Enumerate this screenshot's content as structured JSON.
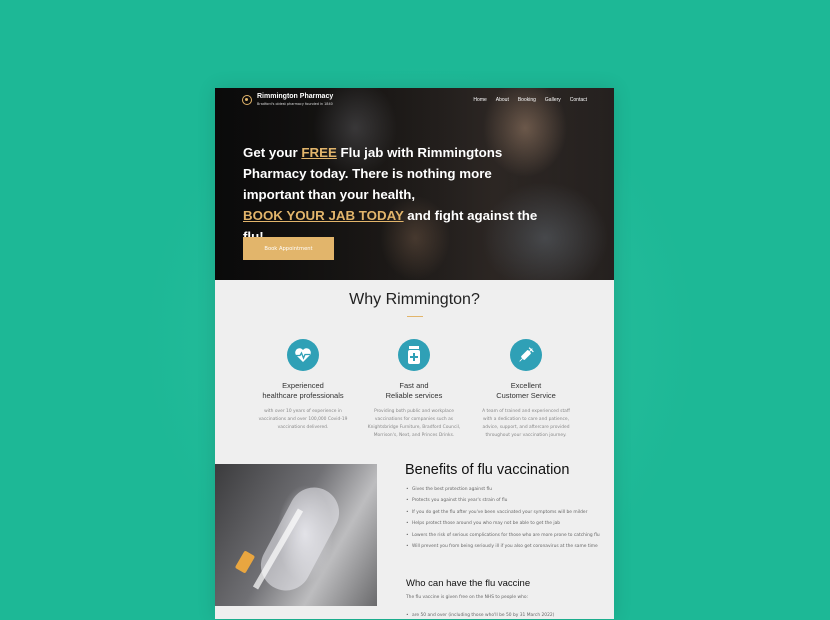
{
  "header": {
    "brand": "Rimmington Pharmacy",
    "tagline": "Bradford's oldest pharmacy founded in 1840",
    "nav": [
      "Home",
      "About",
      "Booking",
      "Gallery",
      "Contact"
    ]
  },
  "hero": {
    "part1": "Get your ",
    "free": "FREE",
    "part2": " Flu jab with Rimmingtons Pharmacy today. There is nothing more important than your health,",
    "book_link": "BOOK YOUR JAB TODAY",
    "part3": " and fight against the flu!",
    "button": "Book Appointment"
  },
  "why": {
    "title": "Why Rimmington?",
    "features": [
      {
        "icon": "heartbeat-icon",
        "title_line1": "Experienced",
        "title_line2": "healthcare professionals",
        "desc": "with over 10 years of experience in vaccinations and over 100,000 Covid-19 vaccinations delivered."
      },
      {
        "icon": "medicine-bottle-icon",
        "title_line1": "Fast and",
        "title_line2": "Reliable services",
        "desc": "Providing both public and workplace vaccinations for companies such as Knightsbridge Furniture, Bradford Council, Morrison's, Next, and Princes Drinks."
      },
      {
        "icon": "syringe-icon",
        "title_line1": "Excellent",
        "title_line2": "Customer Service",
        "desc": "A team of trained and experienced staff with a dedication to care and patience, advice, support, and aftercare provided throughout your vaccination journey."
      }
    ]
  },
  "benefits": {
    "title": "Benefits of flu vaccination",
    "items": [
      "Gives the best protection against flu",
      "Protects you against this year's strain of flu",
      "If you do get the flu after you've been vaccinated your symptoms will be milder",
      "Helps protect those around you who may not be able to get the jab",
      "Lowers the risk of serious complications for those who are more prone to catching flu",
      "Will prevent you from being seriously ill if you also get coronavirus at the same time"
    ]
  },
  "who": {
    "title": "Who can have the flu vaccine",
    "intro": "The flu vaccine is given free on the NHS to people who:",
    "first_item": "are 50 and over (including those who'll be 50 by 31 March 2022)"
  },
  "colors": {
    "background": "#1db896",
    "accent": "#e2b56b",
    "icon_circle": "#2fa0b6"
  }
}
